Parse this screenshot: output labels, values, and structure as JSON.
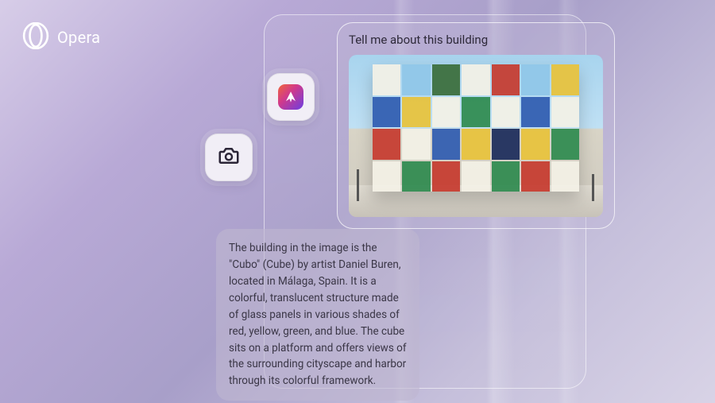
{
  "brand": {
    "name": "Opera"
  },
  "chat": {
    "user_prompt": "Tell me about this building",
    "response": "The building in the image is the \"Cubo\" (Cube) by artist Daniel Buren, located in Málaga, Spain. It is a colorful, translucent structure made of glass panels in various shades of red, yellow, green, and blue. The cube sits on a platform and offers views of the surrounding cityscape and harbor through its colorful framework."
  },
  "icons": {
    "aria": "aria-icon",
    "camera": "camera-icon"
  }
}
